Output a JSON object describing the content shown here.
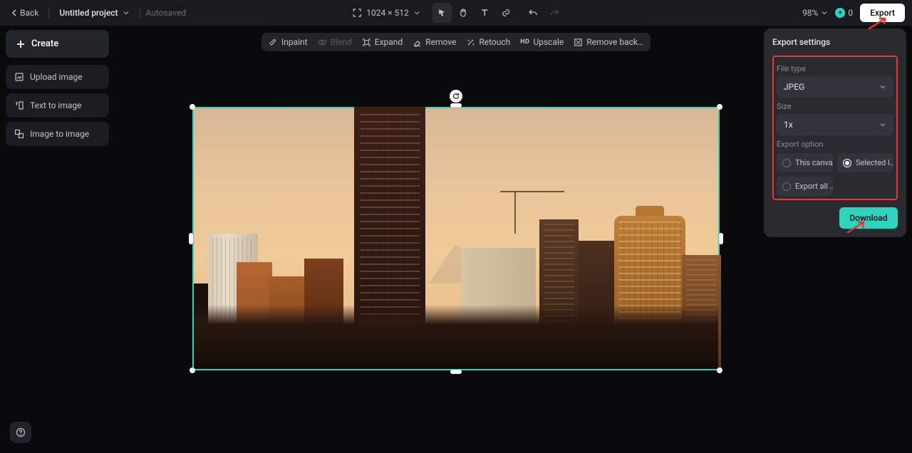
{
  "topbar": {
    "back": "Back",
    "projectName": "Untitled project",
    "autosaved": "Autosaved",
    "canvasSize": "1024 × 512",
    "zoom": "98%",
    "credits": "0",
    "export": "Export"
  },
  "sidebar": {
    "create": "Create",
    "uploadImage": "Upload image",
    "textToImage": "Text to image",
    "imageToImage": "Image to image"
  },
  "tools": {
    "inpaint": "Inpaint",
    "blend": "Blend",
    "expand": "Expand",
    "remove": "Remove",
    "retouch": "Retouch",
    "upscale": "Upscale",
    "removeBack": "Remove back…"
  },
  "exportPanel": {
    "title": "Export settings",
    "fileTypeLabel": "File type",
    "fileType": "JPEG",
    "sizeLabel": "Size",
    "size": "1x",
    "optionLabel": "Export option",
    "optThisCanvas": "This canvas",
    "optSelected": "Selected l…",
    "optExportAll": "Export all …",
    "download": "Download"
  },
  "help": "?"
}
